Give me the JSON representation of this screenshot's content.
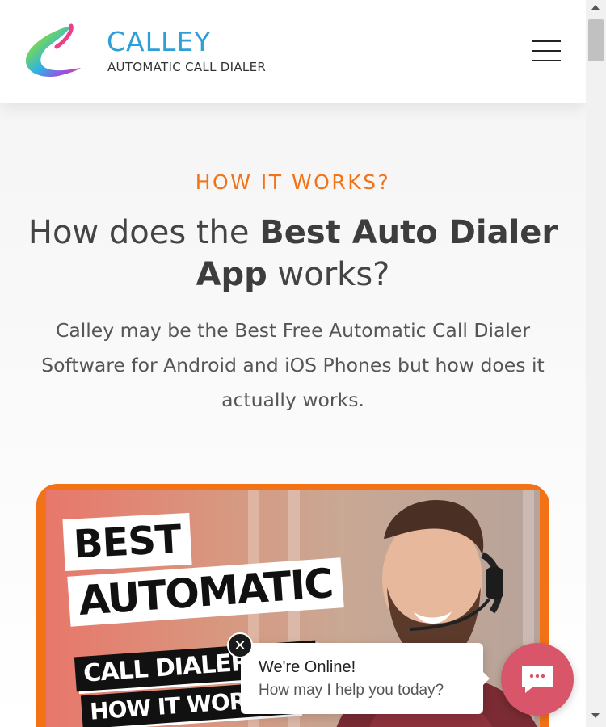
{
  "header": {
    "brand_name": "CALLEY",
    "brand_tagline": "AUTOMATIC CALL DIALER",
    "menu_icon": "hamburger-menu-icon"
  },
  "hero": {
    "eyebrow": "HOW IT WORKS?",
    "headline_prefix": "How does the ",
    "headline_bold1": "Best Auto Dialer",
    "headline_bold2": "App",
    "headline_suffix": " works?",
    "lead": "Calley may be the Best Free Automatic Call Dialer Software for Android and iOS Phones but how does it actually works."
  },
  "video": {
    "sticker_best": "BEST",
    "sticker_automatic": "AUTOMATIC",
    "sticker_call": "CALL DIALER APP",
    "sticker_how": "HOW IT WORKS?",
    "accent": "#f47216"
  },
  "chat": {
    "close_label": "✕",
    "title": "We're Online!",
    "subtitle": "How may I help you today?",
    "launcher_icon": "chat-bubble-icon",
    "launcher_color": "#d9566a"
  }
}
